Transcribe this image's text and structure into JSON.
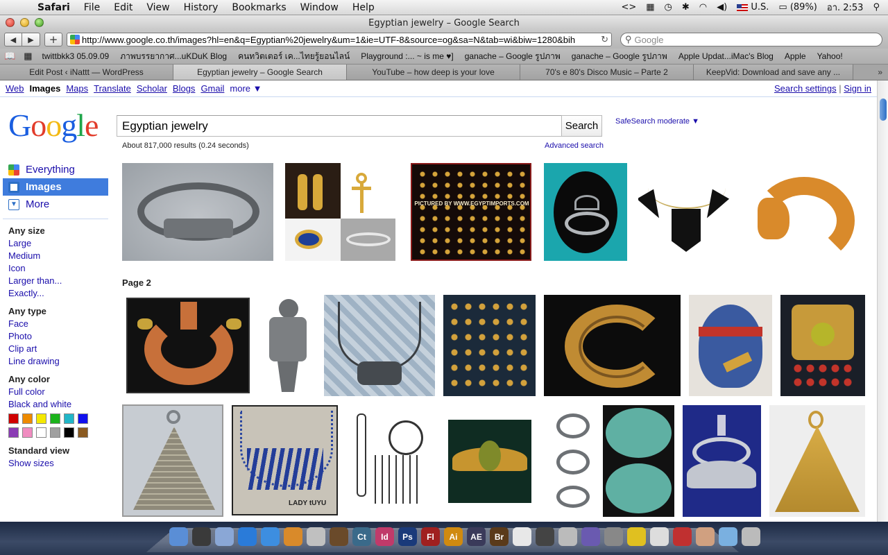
{
  "menubar": {
    "app": "Safari",
    "items": [
      "File",
      "Edit",
      "View",
      "History",
      "Bookmarks",
      "Window",
      "Help"
    ],
    "right": {
      "input": "U.S.",
      "battery": "(89%)",
      "clock": "อา. 2:53"
    }
  },
  "window": {
    "title": "Egyptian jewelry – Google Search"
  },
  "toolbar": {
    "url": "http://www.google.co.th/images?hl=en&q=Egyptian%20jewelry&um=1&ie=UTF-8&source=og&sa=N&tab=wi&biw=1280&bih",
    "search_placeholder": "Google"
  },
  "bookmarks": [
    "twittbkk3 05.09.09",
    "ภาพบรรยากาศ...uKDuK Blog",
    "คนทวิตเตอร์ เค...ไทยรู้ยอนไลน์",
    "Playground :... ~ is me ♥]",
    "ganache – Google รูปภาพ",
    "ganache – Google รูปภาพ",
    "Apple Updat...iMac's Blog",
    "Apple",
    "Yahoo!"
  ],
  "tabs": [
    {
      "label": "Edit Post ‹ iNattt — WordPress",
      "active": false
    },
    {
      "label": "Egyptian jewelry – Google Search",
      "active": true
    },
    {
      "label": "YouTube – how deep is your love",
      "active": false
    },
    {
      "label": "70's e 80's Disco Music – Parte 2",
      "active": false
    },
    {
      "label": "KeepVid: Download and save any ...",
      "active": false
    }
  ],
  "google": {
    "gbar": [
      "Web",
      "Images",
      "Maps",
      "Translate",
      "Scholar",
      "Blogs",
      "Gmail",
      "more ▼"
    ],
    "gbar_current": "Images",
    "search_settings": "Search settings",
    "sign_in": "Sign in",
    "separator": "|",
    "logo": [
      "G",
      "o",
      "o",
      "g",
      "l",
      "e"
    ],
    "query": "Egyptian jewelry",
    "search_button": "Search",
    "safesearch": "SafeSearch moderate ▼",
    "stats": "About 817,000 results (0.24 seconds)",
    "advanced": "Advanced search",
    "nav": [
      {
        "label": "Everything",
        "icon": "everything-icon",
        "selected": false
      },
      {
        "label": "Images",
        "icon": "images-icon",
        "selected": true
      },
      {
        "label": "More",
        "icon": "more-chevron-icon",
        "selected": false
      }
    ],
    "filters": [
      {
        "heading": "Any size",
        "options": [
          "Large",
          "Medium",
          "Icon",
          "Larger than...",
          "Exactly..."
        ]
      },
      {
        "heading": "Any type",
        "options": [
          "Face",
          "Photo",
          "Clip art",
          "Line drawing"
        ]
      },
      {
        "heading": "Any color",
        "options": [
          "Full color",
          "Black and white"
        ]
      }
    ],
    "color_swatches": [
      "#d00000",
      "#ee8a00",
      "#f4e800",
      "#1bb31b",
      "#21b6c8",
      "#1010ee",
      "#8a3cb4",
      "#f08cc0",
      "#ffffff",
      "#a0a0a0",
      "#000000",
      "#8a5a20"
    ],
    "view": {
      "heading": "Standard view",
      "option": "Show sizes"
    },
    "page2_label": "Page 2",
    "thumbnails": [
      {
        "name": "silver-bracelet-thumbnail",
        "desc": "silver bracelet"
      },
      {
        "name": "gold-cartouche-ankh-collage-thumbnail",
        "desc": "gold pendants collage"
      },
      {
        "name": "hieroglyph-alphabet-charms-thumbnail",
        "desc": "gold hieroglyph charms",
        "caption": "PICTURED BY WWW.EGYPTIMPORTS.COM"
      },
      {
        "name": "eye-of-horus-earring-thumbnail",
        "desc": "eye of horus earring"
      },
      {
        "name": "black-spike-necklace-thumbnail",
        "desc": "black spike necklace"
      },
      {
        "name": "orange-collar-thumbnail",
        "desc": "orange collar"
      },
      {
        "name": "broad-collar-necklace-thumbnail",
        "desc": "broad collar necklace"
      },
      {
        "name": "pewter-falcon-pendant-thumbnail",
        "desc": "falcon pendant"
      },
      {
        "name": "silver-chain-necklace-thumbnail",
        "desc": "silver chain necklace"
      },
      {
        "name": "ankh-charms-display-thumbnail",
        "desc": "ankh charms display"
      },
      {
        "name": "gold-collar-dark-thumbnail",
        "desc": "gold collar"
      },
      {
        "name": "blue-beaded-headpiece-thumbnail",
        "desc": "beaded headpiece"
      },
      {
        "name": "gold-pectoral-thumbnail",
        "desc": "gold pectoral"
      },
      {
        "name": "silver-pyramid-pendant-thumbnail",
        "desc": "silver pyramid pendant"
      },
      {
        "name": "lapis-necklace-thumbnail",
        "desc": "lapis necklace",
        "caption": "LADY tUYU"
      },
      {
        "name": "engraved-earrings-drawing-thumbnail",
        "desc": "engraved earrings"
      },
      {
        "name": "gold-winged-scarab-thumbnail",
        "desc": "winged scarab"
      },
      {
        "name": "eye-of-horus-rings-thumbnail",
        "desc": "eye of horus rings"
      },
      {
        "name": "turquoise-scarabs-thumbnail",
        "desc": "turquoise scarabs"
      },
      {
        "name": "silver-winged-pendant-thumbnail",
        "desc": "winged pendant"
      },
      {
        "name": "gold-pyramid-pendant-thumbnail",
        "desc": "gold pyramid pendant"
      }
    ]
  },
  "colors": {
    "link": "#1a0dab",
    "selected_nav": "#3f7cdd",
    "logo": [
      "#1a5ee0",
      "#e23c2b",
      "#f3b914",
      "#1a5ee0",
      "#1fa64a",
      "#e23c2b"
    ]
  },
  "dock": [
    "finder-icon",
    "dashboard-icon",
    "preview-icon",
    "safari-icon",
    "itunes-icon",
    "iphoto-icon",
    "imovie-icon",
    "garageband-icon",
    "contribute-icon",
    "indesign-icon",
    "photoshop-icon",
    "flash-icon",
    "illustrator-icon",
    "after-effects-icon",
    "bridge-icon",
    "textedit-icon",
    "photo-booth-icon",
    "system-icon",
    "paint-icon",
    "mail-icon",
    "bird-icon",
    "document-icon",
    "stamp-icon",
    "pencil-icon",
    "folder-icon",
    "trash-icon"
  ],
  "dock_labels": {
    "contribute-icon": "Ct",
    "indesign-icon": "Id",
    "photoshop-icon": "Ps",
    "flash-icon": "Fl",
    "illustrator-icon": "Ai",
    "after-effects-icon": "AE",
    "bridge-icon": "Br"
  }
}
